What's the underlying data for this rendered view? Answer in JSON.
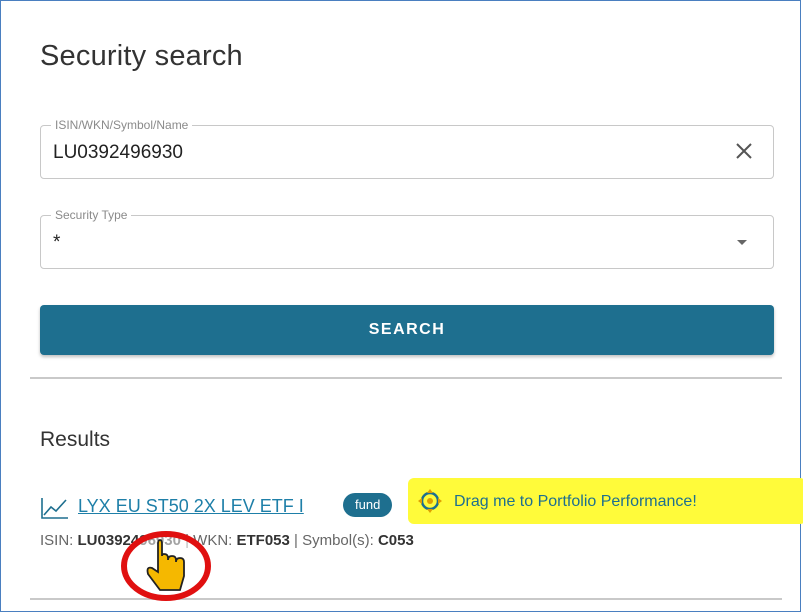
{
  "page": {
    "title": "Security search"
  },
  "search_field": {
    "label": "ISIN/WKN/Symbol/Name",
    "value": "LU0392496930",
    "icon": "close-icon"
  },
  "type_field": {
    "label": "Security Type",
    "value": "*",
    "icon": "chevron-down-icon"
  },
  "search_button": {
    "label": "SEARCH"
  },
  "results": {
    "title": "Results",
    "items": [
      {
        "name": "LYX EU ST50 2X LEV ETF I",
        "type_badge": "fund",
        "drag_hint": "Drag me to Portfolio Performance!",
        "isin_label": "ISIN: ",
        "isin": "LU0392496930",
        "wkn_label": " | WKN: ",
        "wkn": "ETF053",
        "symbol_label": " | Symbol(s): ",
        "symbol": "C053"
      }
    ]
  },
  "colors": {
    "accent": "#1e6f8f",
    "highlight": "#fffb3a",
    "cursor_ring": "#e01010"
  }
}
